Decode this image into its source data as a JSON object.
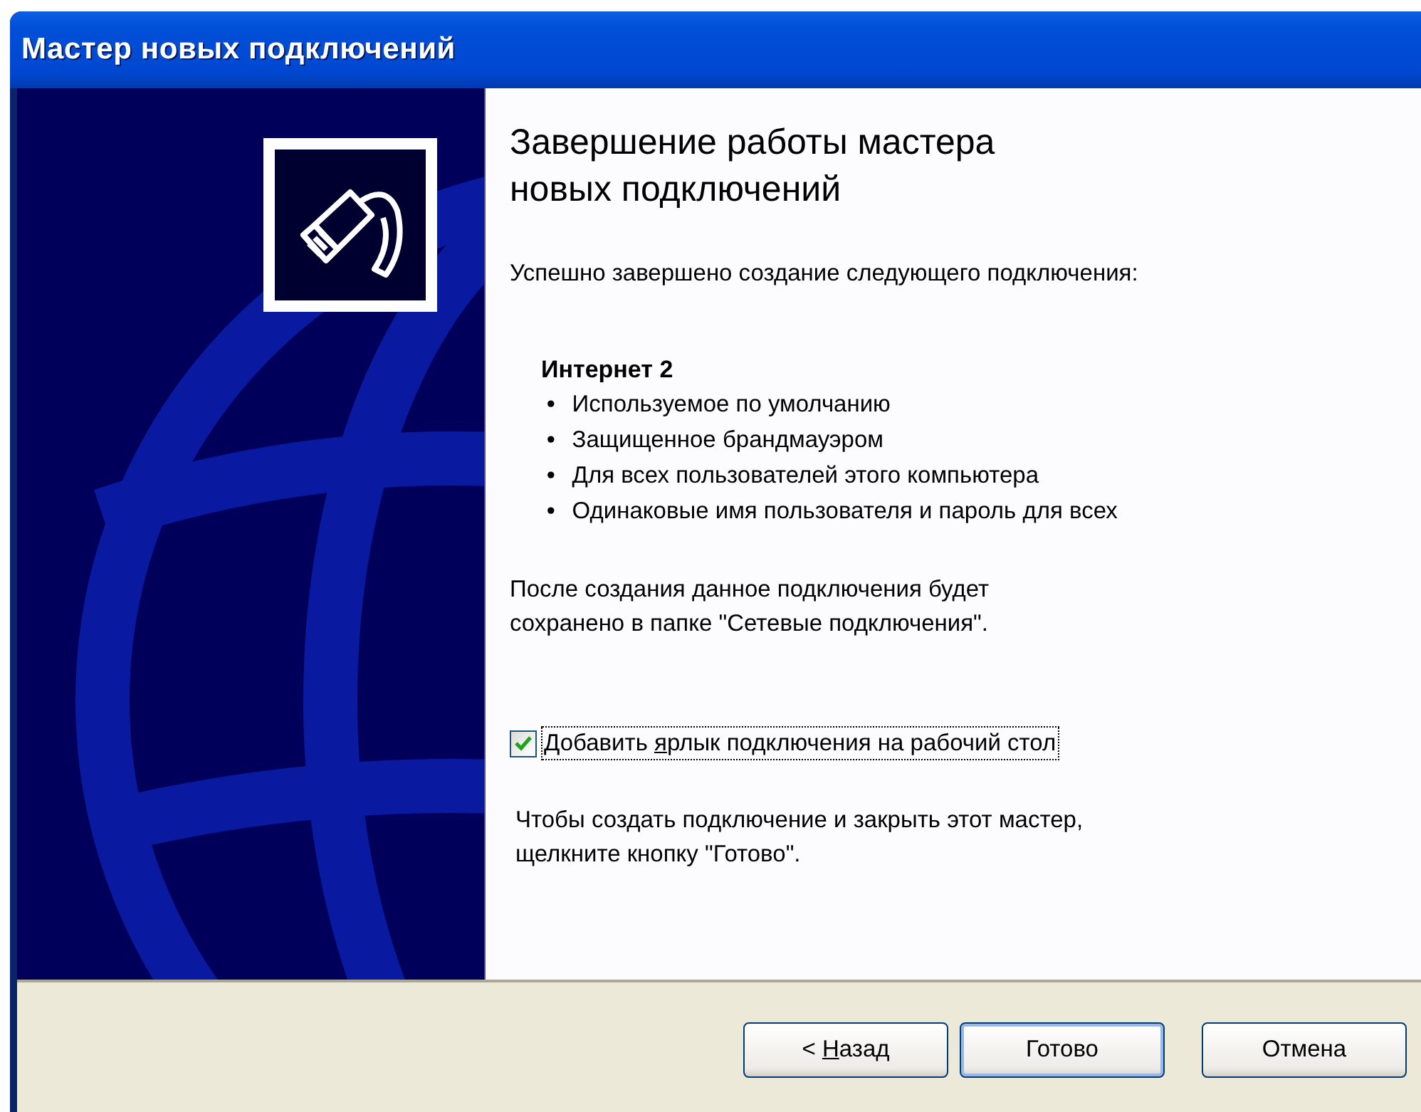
{
  "window": {
    "title": "Мастер новых подключений"
  },
  "heading": "Завершение работы мастера новых подключений",
  "intro": "Успешно завершено создание следующего подключения:",
  "connection": {
    "name": "Интернет 2",
    "bullet": "•",
    "properties": [
      "Используемое по умолчанию",
      "Защищенное брандмауэром",
      "Для всех пользователей этого компьютера",
      "Одинаковые имя пользователя и пароль для всех"
    ]
  },
  "note": "После создания данное подключения будет сохранено в папке \"Сетевые подключения\".",
  "shortcut_checkbox": {
    "label": {
      "before": "Добавить ",
      "key": "я",
      "after": "рлык подключения на рабочий стол"
    },
    "checked": true,
    "focused": true
  },
  "finish_hint": "Чтобы создать подключение и закрыть этот мастер, щелкните кнопку \"Готово\".",
  "buttons": [
    {
      "label": {
        "before": "< ",
        "key": "Н",
        "after": "азад"
      },
      "default": false
    },
    {
      "label": {
        "before": "Готово"
      },
      "default": true
    },
    {
      "label": {
        "before": "Отмена"
      },
      "default": false
    }
  ]
}
